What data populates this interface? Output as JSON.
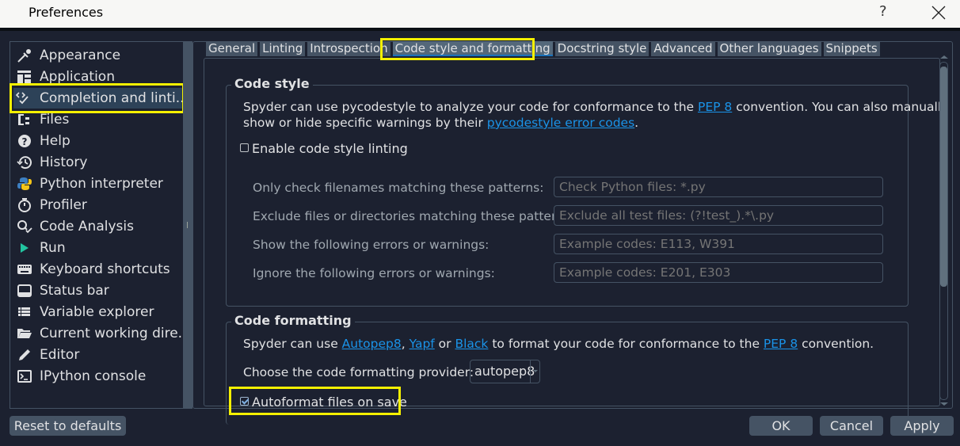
{
  "window": {
    "title": "Preferences",
    "help_label": "?",
    "close_icon": "close-icon"
  },
  "sidebar": {
    "items": [
      {
        "label": "Appearance",
        "icon": "eyedropper-icon"
      },
      {
        "label": "Application",
        "icon": "layout-icon"
      },
      {
        "label": "Completion and linti...",
        "icon": "code-check-icon",
        "selected": true
      },
      {
        "label": "Files",
        "icon": "files-icon"
      },
      {
        "label": "Help",
        "icon": "help-icon"
      },
      {
        "label": "History",
        "icon": "history-icon"
      },
      {
        "label": "Python interpreter",
        "icon": "python-icon"
      },
      {
        "label": "Profiler",
        "icon": "stopwatch-icon"
      },
      {
        "label": "Code Analysis",
        "icon": "code-analysis-icon"
      },
      {
        "label": "Run",
        "icon": "run-icon"
      },
      {
        "label": "Keyboard shortcuts",
        "icon": "keyboard-icon"
      },
      {
        "label": "Status bar",
        "icon": "statusbar-icon"
      },
      {
        "label": "Variable explorer",
        "icon": "table-icon"
      },
      {
        "label": "Current working dire...",
        "icon": "folder-open-icon"
      },
      {
        "label": "Editor",
        "icon": "pencil-icon"
      },
      {
        "label": "IPython console",
        "icon": "terminal-icon"
      }
    ]
  },
  "tabs": [
    {
      "label": "General"
    },
    {
      "label": "Linting"
    },
    {
      "label": "Introspection"
    },
    {
      "label": "Code style and formatting",
      "active": true
    },
    {
      "label": "Docstring style"
    },
    {
      "label": "Advanced"
    },
    {
      "label": "Other languages"
    },
    {
      "label": "Snippets"
    }
  ],
  "code_style": {
    "title": "Code style",
    "desc_line1_a": "Spyder can use pycodestyle to analyze your code for conformance to the ",
    "desc_line1_link": "PEP 8",
    "desc_line1_b": " convention. You can also manually",
    "desc_line2_a": "show or hide specific warnings by their ",
    "desc_line2_link": "pycodestyle error codes",
    "desc_line2_b": ".",
    "enable_label": "Enable code style linting",
    "enable_checked": false,
    "fields": [
      {
        "label": "Only check filenames matching these patterns:",
        "value": "",
        "placeholder": "Check Python files: *.py"
      },
      {
        "label": "Exclude files or directories matching these patterns:",
        "value": "",
        "placeholder": "Exclude all test files: (?!test_).*\\.py"
      },
      {
        "label": "Show the following errors or warnings:",
        "value": "",
        "placeholder": "Example codes: E113, W391"
      },
      {
        "label": "Ignore the following errors or warnings:",
        "value": "",
        "placeholder": "Example codes: E201, E303"
      }
    ]
  },
  "code_formatting": {
    "title": "Code formatting",
    "desc_a": "Spyder can use ",
    "link_autopep8": "Autopep8",
    "sep1": ", ",
    "link_yapf": "Yapf",
    "sep2": " or ",
    "link_black": "Black",
    "desc_b": " to format your code for conformance to the ",
    "link_pep8": "PEP 8",
    "desc_c": " convention.",
    "provider_label": "Choose the code formatting provider:",
    "provider_value": "autopep8",
    "autoformat_label": "Autoformat files on save",
    "autoformat_checked": true
  },
  "footer": {
    "reset_label": "Reset to defaults",
    "ok_label": "OK",
    "cancel_label": "Cancel",
    "apply_label": "Apply"
  },
  "colors": {
    "highlight": "#f5f000",
    "link": "#1a93e8",
    "selected_bg": "#2d4258"
  }
}
